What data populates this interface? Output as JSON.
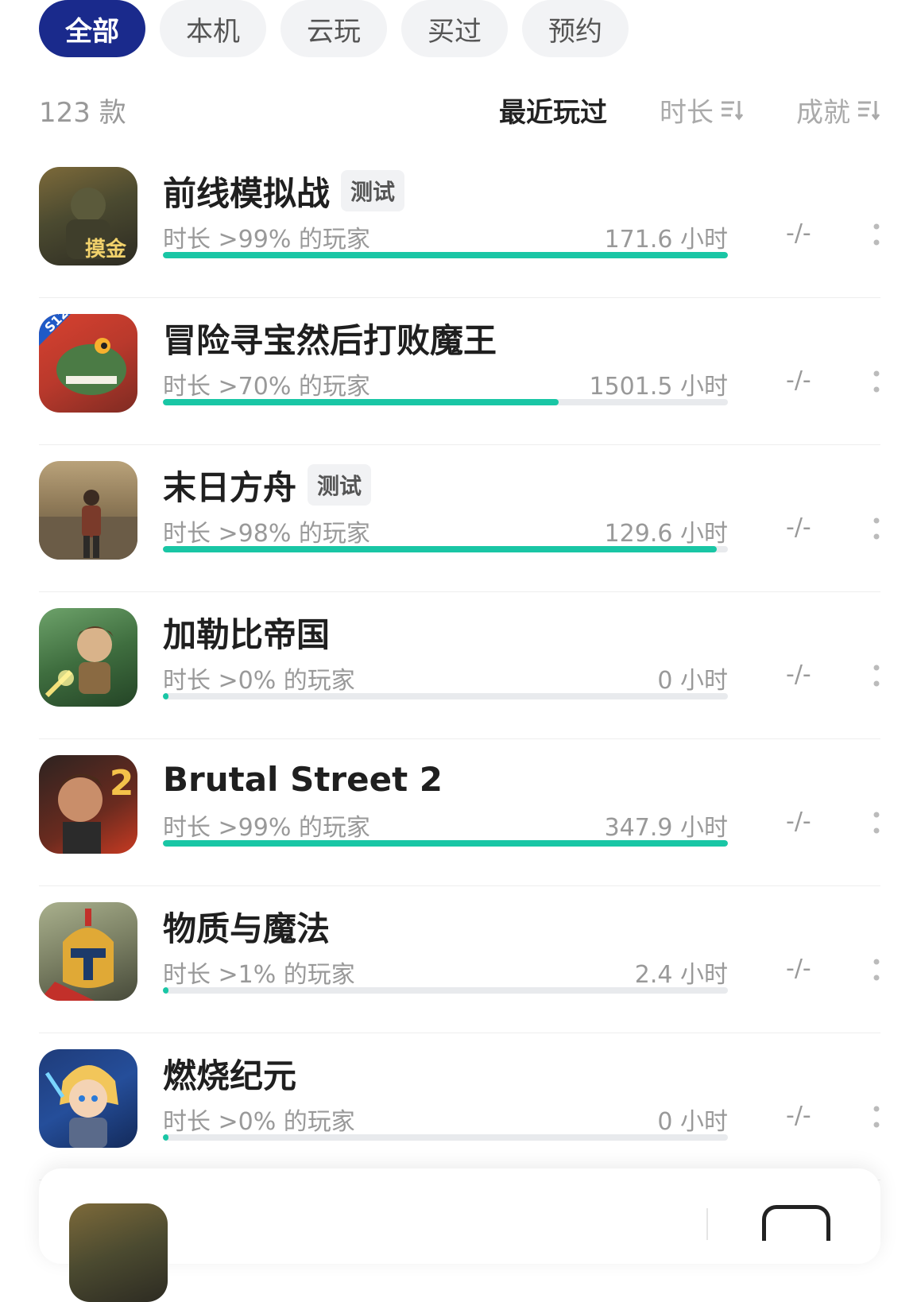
{
  "filters": [
    {
      "label": "全部",
      "active": true
    },
    {
      "label": "本机",
      "active": false
    },
    {
      "label": "云玩",
      "active": false
    },
    {
      "label": "买过",
      "active": false
    },
    {
      "label": "预约",
      "active": false
    }
  ],
  "sortbar": {
    "count": "123 款",
    "recent": "最近玩过",
    "duration": "时长",
    "achievement": "成就"
  },
  "games": [
    {
      "title": "前线模拟战",
      "badge": "测试",
      "sub": "时长 >99% 的玩家",
      "hours": "171.6 小时",
      "progress": 1.0,
      "ach": "-/-",
      "icon": "game-icon-soldier"
    },
    {
      "title": "冒险寻宝然后打败魔王",
      "badge": "",
      "sub": "时长 >70% 的玩家",
      "hours": "1501.5 小时",
      "progress": 0.7,
      "ach": "-/-",
      "icon": "game-icon-crocodile"
    },
    {
      "title": "末日方舟",
      "badge": "测试",
      "sub": "时长 >98% 的玩家",
      "hours": "129.6 小时",
      "progress": 0.98,
      "ach": "-/-",
      "icon": "game-icon-wasteland"
    },
    {
      "title": "加勒比帝国",
      "badge": "",
      "sub": "时长 >0% 的玩家",
      "hours": "0 小时",
      "progress": 0.01,
      "ach": "-/-",
      "icon": "game-icon-pirate"
    },
    {
      "title": "Brutal Street 2",
      "badge": "",
      "sub": "时长 >99% 的玩家",
      "hours": "347.9 小时",
      "progress": 1.0,
      "ach": "-/-",
      "icon": "game-icon-brawler"
    },
    {
      "title": "物质与魔法",
      "badge": "",
      "sub": "时长 >1% 的玩家",
      "hours": "2.4 小时",
      "progress": 0.01,
      "ach": "-/-",
      "icon": "game-icon-spartan"
    },
    {
      "title": "燃烧纪元",
      "badge": "",
      "sub": "时长 >0% 的玩家",
      "hours": "0 小时",
      "progress": 0.01,
      "ach": "-/-",
      "icon": "game-icon-hero"
    }
  ],
  "colors": {
    "accent": "#1a2a8c",
    "progress": "#19c6a5",
    "track": "#e8eaed"
  }
}
